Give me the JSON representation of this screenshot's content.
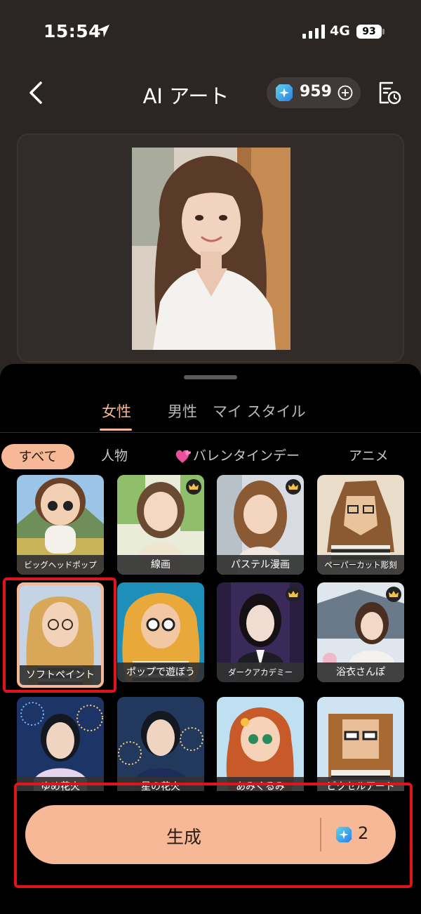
{
  "status_bar": {
    "time": "15:54",
    "network": "4G",
    "battery": "93"
  },
  "header": {
    "title": "AI アート",
    "credits": "959"
  },
  "tabs": [
    {
      "label": "女性",
      "active": true
    },
    {
      "label": "男性",
      "active": false
    },
    {
      "label": "マイ スタイル",
      "active": false
    }
  ],
  "categories": [
    {
      "label": "すべて",
      "active": true
    },
    {
      "label": "人物",
      "active": false
    },
    {
      "label": "バレンタインデー",
      "active": false,
      "icon": "hearts-icon"
    },
    {
      "label": "アニメ",
      "active": false
    }
  ],
  "styles": [
    {
      "label": "ビッグヘッドポップ",
      "premium": false,
      "selected": false
    },
    {
      "label": "線画",
      "premium": true,
      "selected": false
    },
    {
      "label": "パステル漫画",
      "premium": true,
      "selected": false
    },
    {
      "label": "ペーパーカット彫刻",
      "premium": false,
      "selected": false
    },
    {
      "label": "ソフトペイント",
      "premium": false,
      "selected": true
    },
    {
      "label": "ポップで遊ぼう",
      "premium": false,
      "selected": false
    },
    {
      "label": "ダークアカデミー",
      "premium": true,
      "selected": false
    },
    {
      "label": "浴衣さんぽ",
      "premium": true,
      "selected": false
    },
    {
      "label": "ゆめ花火",
      "premium": false,
      "selected": false
    },
    {
      "label": "星の花火",
      "premium": false,
      "selected": false
    },
    {
      "label": "あみぐるみ",
      "premium": false,
      "selected": false
    },
    {
      "label": "ピクセルアート",
      "premium": false,
      "selected": false
    }
  ],
  "generate": {
    "label": "生成",
    "cost": "2"
  },
  "colors": {
    "accent": "#f6b896",
    "highlight": "#e0141b",
    "background": "#2b2523"
  }
}
